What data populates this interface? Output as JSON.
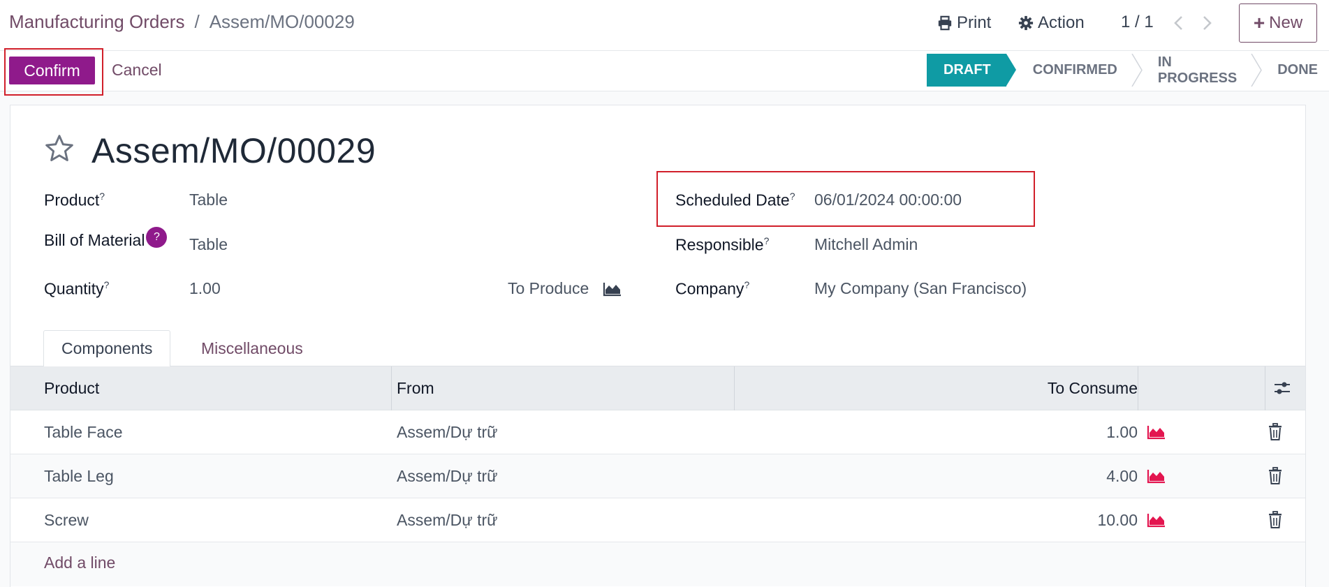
{
  "breadcrumb": {
    "parent": "Manufacturing Orders",
    "separator": "/",
    "current": "Assem/MO/00029"
  },
  "toolbar": {
    "print_label": "Print",
    "action_label": "Action",
    "pager": "1 / 1",
    "new_label": "New"
  },
  "actions": {
    "confirm_label": "Confirm",
    "cancel_label": "Cancel"
  },
  "statusbar": {
    "stages": [
      "DRAFT",
      "CONFIRMED",
      "IN PROGRESS",
      "DONE"
    ],
    "active": "DRAFT"
  },
  "record": {
    "title": "Assem/MO/00029"
  },
  "fields": {
    "product": {
      "label": "Product",
      "help": "?",
      "value": "Table"
    },
    "bom": {
      "label": "Bill of Material",
      "help": "?",
      "value": "Table"
    },
    "quantity": {
      "label": "Quantity",
      "help": "?",
      "value": "1.00",
      "uom": "To Produce"
    },
    "scheduled_date": {
      "label": "Scheduled Date",
      "help": "?",
      "value": "06/01/2024 00:00:00"
    },
    "responsible": {
      "label": "Responsible",
      "help": "?",
      "value": "Mitchell Admin"
    },
    "company": {
      "label": "Company",
      "help": "?",
      "value": "My Company (San Francisco)"
    }
  },
  "tabs": [
    {
      "label": "Components"
    },
    {
      "label": "Miscellaneous"
    }
  ],
  "components": {
    "columns": {
      "product": "Product",
      "from": "From",
      "to_consume": "To Consume"
    },
    "rows": [
      {
        "product": "Table Face",
        "from": "Assem/Dự trữ",
        "to_consume": "1.00"
      },
      {
        "product": "Table Leg",
        "from": "Assem/Dự trữ",
        "to_consume": "4.00"
      },
      {
        "product": "Screw",
        "from": "Assem/Dự trữ",
        "to_consume": "10.00"
      }
    ],
    "add_line_label": "Add a line"
  },
  "colors": {
    "brand": "#714b67",
    "primary_button": "#8f1a8b",
    "active_stage": "#0f9ba4",
    "forecast_icon": "#e3154f",
    "highlight": "#d11f2a"
  },
  "icons": [
    "print-icon",
    "gear-icon",
    "chevron-left-icon",
    "chevron-right-icon",
    "plus-icon",
    "star-icon",
    "area-chart-icon",
    "sliders-icon",
    "trash-icon"
  ]
}
